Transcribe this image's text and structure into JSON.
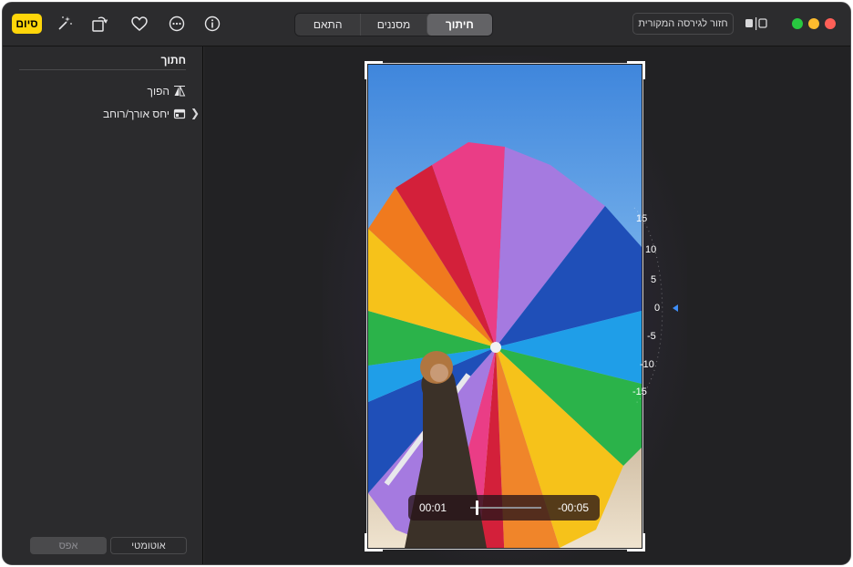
{
  "toolbar": {
    "done_label": "סיום",
    "tabs": [
      {
        "label": "התאם"
      },
      {
        "label": "מסננים"
      },
      {
        "label": "חיתוך"
      }
    ],
    "revert_label": "חזור לגירסה המקורית",
    "traffic_colors": {
      "close": "#ff5f57",
      "minimize": "#febc2e",
      "zoom": "#28c840"
    },
    "accent": "#ffd60a"
  },
  "panel": {
    "title": "חתוך",
    "items": [
      {
        "label": "הפוך",
        "icon": "flip-icon"
      },
      {
        "label": "יחס אורך/רוחב",
        "icon": "aspect-ratio-icon"
      }
    ],
    "auto_label": "אוטומטי",
    "reset_label": "אפס"
  },
  "video": {
    "current": "00:01",
    "remaining": "-00:05"
  },
  "dial": {
    "labels": [
      "15",
      "10",
      "5",
      "0",
      "-5",
      "-10",
      "-15"
    ],
    "value": 0
  }
}
